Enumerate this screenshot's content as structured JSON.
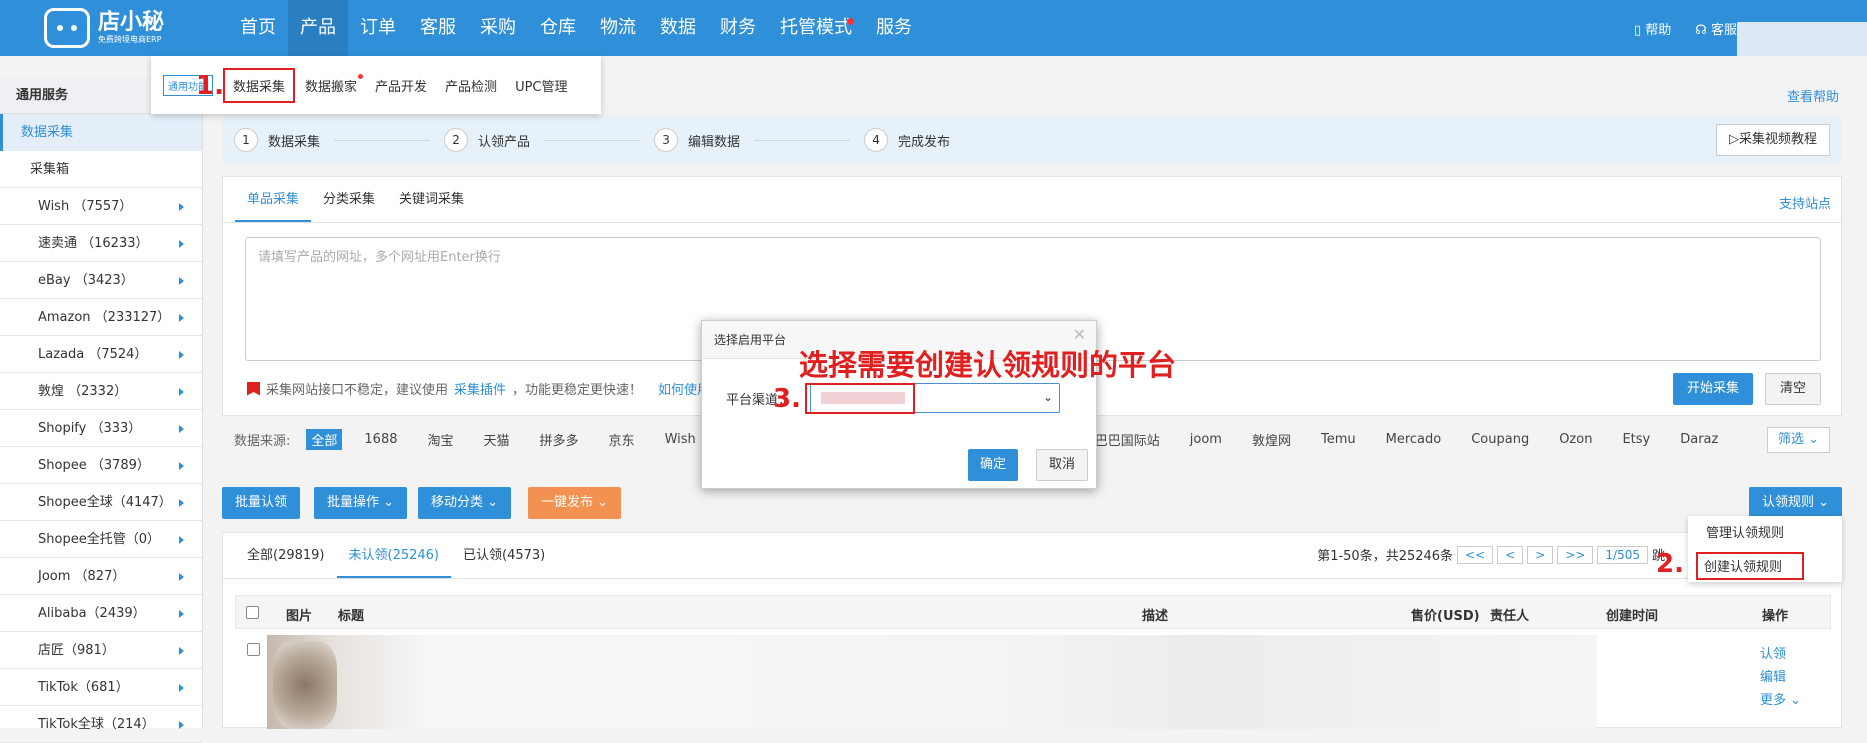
{
  "brand": {
    "name": "店小秘",
    "tagline": "免费跨境电商ERP"
  },
  "nav": {
    "items": [
      "首页",
      "产品",
      "订单",
      "客服",
      "采购",
      "仓库",
      "物流",
      "数据",
      "财务",
      "托管模式",
      "服务"
    ],
    "active_index": 1,
    "help_label": "帮助",
    "service_label": "客服"
  },
  "submenu": {
    "tag": "通用功能",
    "items": [
      "数据采集",
      "数据搬家",
      "产品开发",
      "产品检测",
      "UPC管理"
    ]
  },
  "annotations": {
    "step1": "1.",
    "step2": "2.",
    "step3": "3.",
    "title": "选择需要创建认领规则的平台"
  },
  "sidebar": {
    "section": "通用服务",
    "active": "数据采集",
    "sub": "采集箱",
    "items": [
      "Wish （7557）",
      "速卖通 （16233）",
      "eBay （3423）",
      "Amazon （233127）",
      "Lazada （7524）",
      "敦煌 （2332）",
      "Shopify （333）",
      "Shopee （3789）",
      "Shopee全球（4147）",
      "Shopee全托管（0）",
      "Joom （827）",
      "Alibaba（2439）",
      "店匠（981）",
      "TikTok（681）",
      "TikTok全球（214）"
    ]
  },
  "help_link": "查看帮助",
  "steps": {
    "items": [
      {
        "num": "1",
        "label": "数据采集"
      },
      {
        "num": "2",
        "label": "认领产品"
      },
      {
        "num": "3",
        "label": "编辑数据"
      },
      {
        "num": "4",
        "label": "完成发布"
      }
    ],
    "video_label": "采集视频教程"
  },
  "collect": {
    "tabs": [
      "单品采集",
      "分类采集",
      "关键词采集"
    ],
    "support_label": "支持站点",
    "placeholder": "请填写产品的网址，多个网址用Enter换行",
    "tip_text": "采集网站接口不稳定，建议使用",
    "tip_link": "采集插件",
    "tip_after": "，功能更稳定更快速！",
    "tip_link2": "如何使用插",
    "start_label": "开始采集",
    "clear_label": "清空"
  },
  "sources": {
    "label": "数据来源:",
    "items": [
      "全部",
      "1688",
      "淘宝",
      "天猫",
      "拼多多",
      "京东",
      "Wish"
    ],
    "items_right": [
      "里巴巴国际站",
      "joom",
      "敦煌网",
      "Temu",
      "Mercado",
      "Coupang",
      "Ozon",
      "Etsy",
      "Daraz"
    ],
    "filter_label": "筛选"
  },
  "toolbar": {
    "batch_claim": "批量认领",
    "batch_ops": "批量操作",
    "move_category": "移动分类",
    "one_click_publish": "一键发布",
    "claim_rules": "认领规则"
  },
  "rules_menu": {
    "manage": "管理认领规则",
    "create": "创建认领规则"
  },
  "list": {
    "tabs": [
      "全部(29819)",
      "未认领(25246)",
      "已认领(4573)"
    ],
    "active_tab": 1,
    "pager_text": "第1-50条，共25246条",
    "pager_buttons": [
      "<<",
      "<",
      ">",
      ">>"
    ],
    "page_label": "1/505",
    "page_cut": "跳",
    "columns": [
      "图片",
      "标题",
      "描述",
      "售价(USD)",
      "责任人",
      "创建时间",
      "操作"
    ],
    "row_actions": [
      "认领",
      "编辑",
      "更多"
    ]
  },
  "dialog": {
    "title": "选择启用平台",
    "field_label": "平台渠道：",
    "ok": "确定",
    "cancel": "取消"
  }
}
